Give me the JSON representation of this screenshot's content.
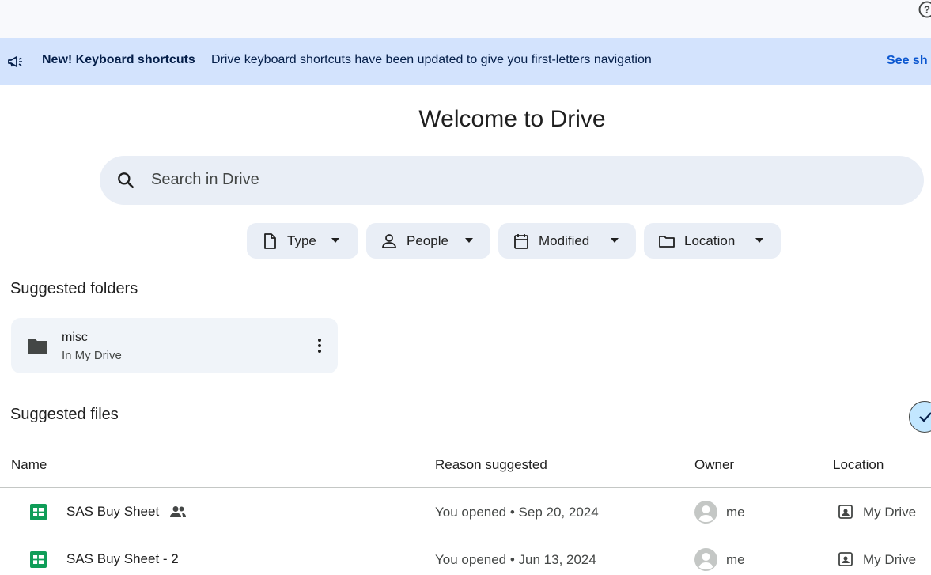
{
  "banner": {
    "title": "New! Keyboard shortcuts",
    "text": "Drive keyboard shortcuts have been updated to give you first-letters navigation",
    "link": "See sh"
  },
  "main": {
    "welcome": "Welcome to Drive",
    "search_placeholder": "Search in Drive"
  },
  "filters": [
    {
      "label": "Type",
      "icon": "file-icon"
    },
    {
      "label": "People",
      "icon": "person-icon"
    },
    {
      "label": "Modified",
      "icon": "calendar-icon"
    },
    {
      "label": "Location",
      "icon": "folder-outline-icon"
    }
  ],
  "suggested_folders": {
    "title": "Suggested folders",
    "items": [
      {
        "name": "misc",
        "location": "In My Drive"
      }
    ]
  },
  "suggested_files": {
    "title": "Suggested files",
    "columns": [
      "Name",
      "Reason suggested",
      "Owner",
      "Location"
    ],
    "rows": [
      {
        "name": "SAS Buy Sheet",
        "shared": true,
        "reason": "You opened • Sep 20, 2024",
        "owner": "me",
        "location": "My Drive"
      },
      {
        "name": "SAS Buy Sheet - 2",
        "shared": false,
        "reason": "You opened • Jun 13, 2024",
        "owner": "me",
        "location": "My Drive"
      }
    ]
  },
  "colors": {
    "banner_bg": "#d3e3fd",
    "search_bg": "#e9eef6",
    "sheets_green": "#0f9d58",
    "link_blue": "#0b57d0"
  }
}
